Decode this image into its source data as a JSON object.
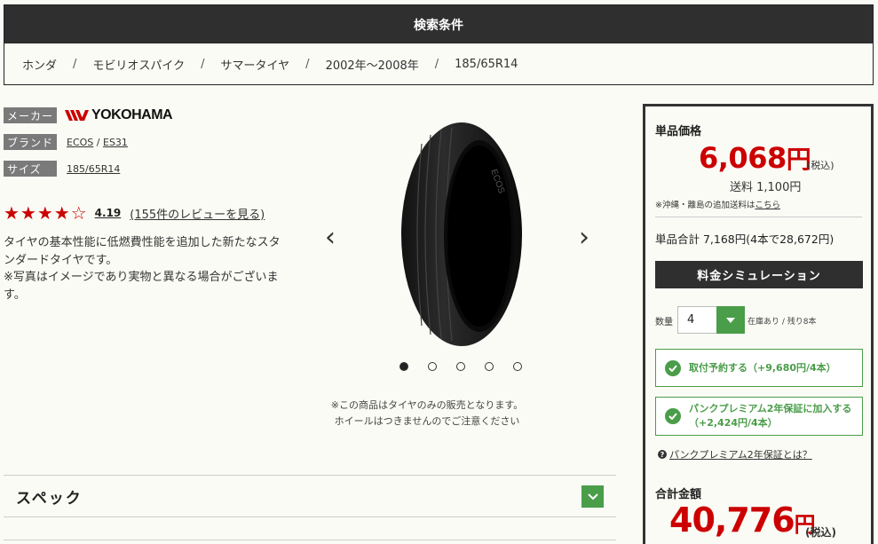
{
  "search": {
    "title": "検索条件",
    "crumbs": [
      "ホンダ",
      "モビリオスパイク",
      "サマータイヤ",
      "2002年～2008年",
      "185/65R14"
    ],
    "sep": "/"
  },
  "product": {
    "maker_label": "メーカー",
    "maker_logo_text": "YOKOHAMA",
    "brand_label": "ブランド",
    "brand_1": "ECOS",
    "brand_sep": "/",
    "brand_2": "ES31",
    "size_label": "サイズ",
    "size_value": "185/65R14",
    "stars": "★★★★☆",
    "rating": 4.19,
    "rating_text": "4.19",
    "reviews_link": "(155件のレビューを見る)",
    "desc_1": "タイヤの基本性能に低燃費性能を追加した新たなスタンダードタイヤです。",
    "desc_2": "※写真はイメージであり実物と異なる場合がございます。"
  },
  "carousel": {
    "prev": "‹",
    "next": "›",
    "dots_count": 5,
    "active_dot": 1,
    "note_1": "※この商品はタイヤのみの販売となります。",
    "note_2": "ホイールはつきませんのでご注意ください"
  },
  "spec": {
    "title": "スペック"
  },
  "panel": {
    "unit_price_label": "単品価格",
    "unit_price": "6,068",
    "yen": "円",
    "tax": "(税込)",
    "shipping": "送料 1,100円",
    "remote_note": "※沖縄・離島の追加送料は",
    "remote_link": "こちら",
    "subtotal": "単品合計 7,168円(4本で28,672円)",
    "sim_button": "料金シミュレーション",
    "qty_label": "数量",
    "qty_value": "4",
    "stock": "在庫あり / 残り8本",
    "option_1": "取付予約する（+9,680円/4本）",
    "option_2": "パンクプレミアム2年保証に加入する（+2,424円/4本）",
    "faq_icon": "?",
    "faq_link": "パンクプレミアム2年保証とは？",
    "total_label": "合計金額",
    "total": "40,776",
    "total_tax": "(税込)"
  },
  "colors": {
    "accent_red": "#cc0000",
    "green": "#4a9d49",
    "dark": "#2f2f2f"
  },
  "icons": [
    "yokohama-logo",
    "chevron-left-icon",
    "chevron-right-icon",
    "chevron-down-icon",
    "check-icon",
    "question-icon"
  ]
}
